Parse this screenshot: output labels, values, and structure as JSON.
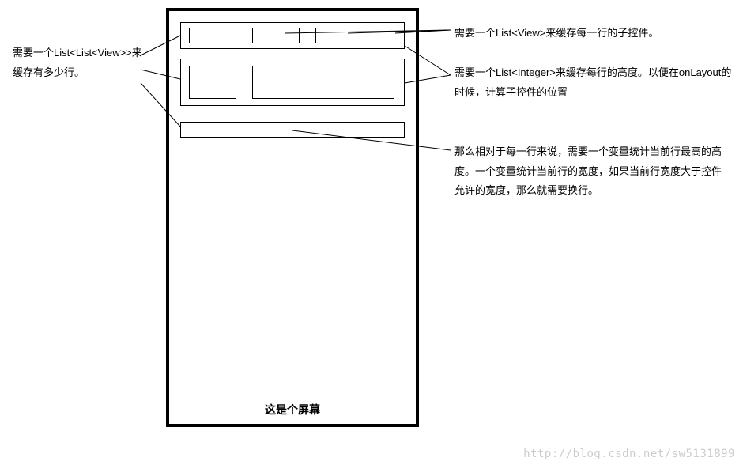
{
  "screen_label": "这是个屏幕",
  "annotations": {
    "left": "需要一个List<List<View>>来缓存有多少行。",
    "right1": "需要一个List<View>来缓存每一行的子控件。",
    "right2": "需要一个List<Integer>来缓存每行的高度。以便在onLayout的时候，计算子控件的位置",
    "right3": "那么相对于每一行来说，需要一个变量统计当前行最高的高度。一个变量统计当前行的宽度，如果当前行宽度大于控件允许的宽度，那么就需要换行。"
  },
  "watermark": "http://blog.csdn.net/sw5131899"
}
